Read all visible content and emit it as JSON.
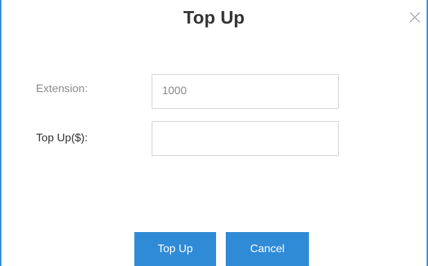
{
  "dialog": {
    "title": "Top Up",
    "close_icon": "close-icon"
  },
  "form": {
    "extension_label": "Extension:",
    "extension_value": "1000",
    "topup_label": "Top Up($):",
    "topup_value": ""
  },
  "buttons": {
    "topup_label": "Top Up",
    "cancel_label": "Cancel"
  },
  "colors": {
    "accent": "#2f8bd6",
    "label_text": "#333333",
    "disabled_text": "#8a8a8a",
    "input_border": "#cfcfcf"
  }
}
